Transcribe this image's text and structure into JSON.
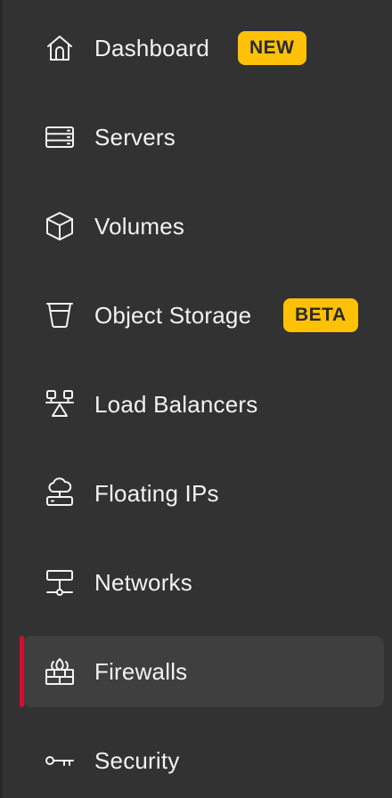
{
  "sidebar": {
    "items": [
      {
        "label": "Dashboard",
        "icon": "home-icon",
        "badge": "NEW"
      },
      {
        "label": "Servers",
        "icon": "server-icon"
      },
      {
        "label": "Volumes",
        "icon": "cube-icon"
      },
      {
        "label": "Object Storage",
        "icon": "bucket-icon",
        "badge": "BETA"
      },
      {
        "label": "Load Balancers",
        "icon": "load-balancer-icon"
      },
      {
        "label": "Floating IPs",
        "icon": "cloud-network-icon"
      },
      {
        "label": "Networks",
        "icon": "network-icon"
      },
      {
        "label": "Firewalls",
        "icon": "firewall-icon",
        "active": true
      },
      {
        "label": "Security",
        "icon": "key-icon"
      }
    ]
  },
  "colors": {
    "background": "#323232",
    "active_background": "#3f3f3f",
    "active_marker": "#d50c2d",
    "badge": "#ffc107",
    "text": "#f2f2f2"
  }
}
